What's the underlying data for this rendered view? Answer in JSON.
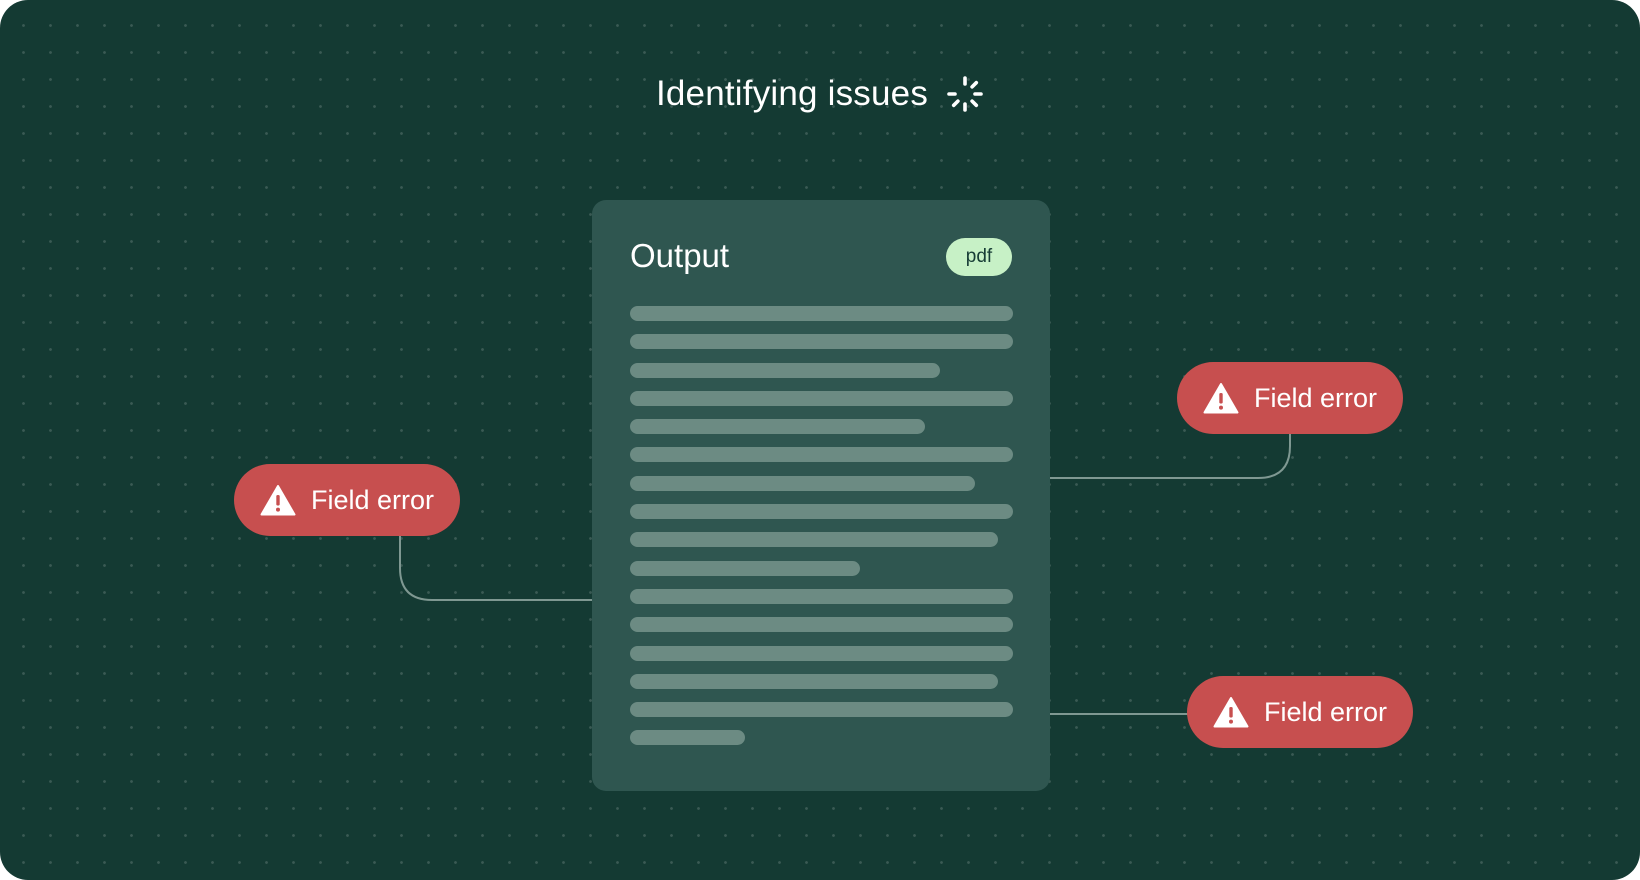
{
  "header": {
    "title": "Identifying issues",
    "status_icon": "loading-spinner-icon"
  },
  "document": {
    "title": "Output",
    "badge": "pdf",
    "placeholder_line_fill": [
      1,
      1,
      0.81,
      1,
      0.77,
      1,
      0.9,
      1,
      0.96,
      0.6,
      1,
      1,
      1,
      0.96,
      1,
      0.3
    ]
  },
  "errors": [
    {
      "label": "Field error",
      "icon": "warning-triangle-icon"
    },
    {
      "label": "Field error",
      "icon": "warning-triangle-icon"
    },
    {
      "label": "Field error",
      "icon": "warning-triangle-icon"
    }
  ],
  "colors": {
    "background": "#143a33",
    "card": "#2f5650",
    "placeholder_line": "#6c8b83",
    "badge": "#c7f1c6",
    "error": "#c74f4f",
    "connector": "#7f9892"
  }
}
